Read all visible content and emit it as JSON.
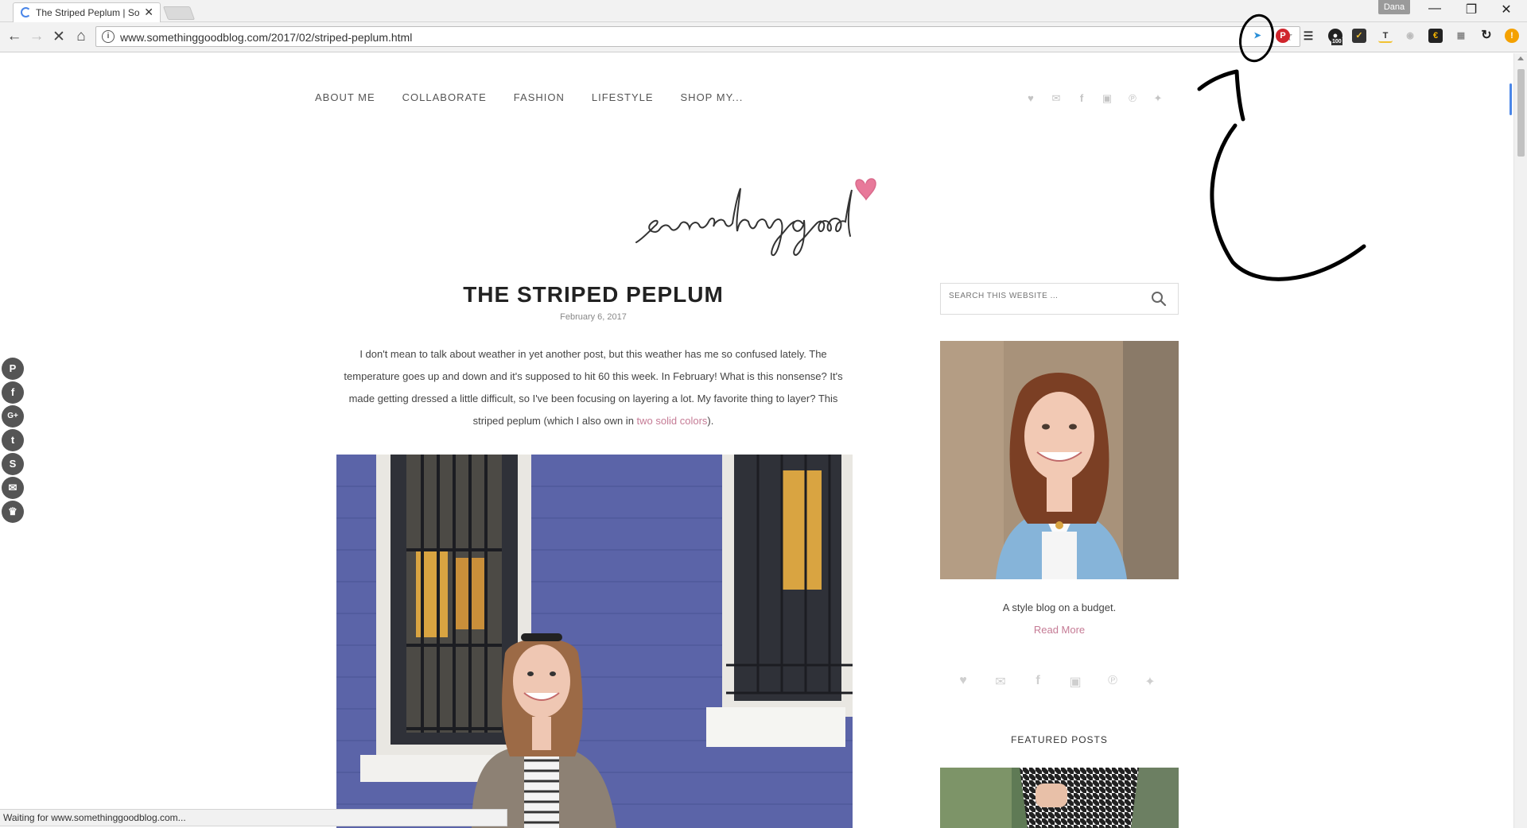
{
  "browser": {
    "tab_title": "The Striped Peplum | Sor",
    "tab_close": "✕",
    "profile_name": "Dana",
    "url": "www.somethinggoodblog.com/2017/02/striped-peplum.html",
    "status_text": "Waiting for www.somethinggoodblog.com...",
    "extension_badge": "100"
  },
  "nav": {
    "items": [
      "ABOUT ME",
      "COLLABORATE",
      "FASHION",
      "LIFESTYLE",
      "SHOP MY..."
    ]
  },
  "social_icons": [
    "heart-icon",
    "mail-icon",
    "facebook-icon",
    "instagram-icon",
    "pinterest-icon",
    "twitter-icon"
  ],
  "post": {
    "title": "THE STRIPED PEPLUM",
    "date": "February 6, 2017",
    "body_before_link": "I don't mean to talk about weather in yet another post, but this weather has me so confused lately. The temperature goes up and down and it's supposed to hit 60 this week. In February! What is this nonsense? It's made getting dressed a little difficult, so I've been focusing on layering a lot. My favorite thing to layer? This striped peplum (which I also own in ",
    "link_text": "two solid colors",
    "body_after_link": ")."
  },
  "sidebar": {
    "search_placeholder": "SEARCH THIS WEBSITE ...",
    "tagline": "A style blog on a budget.",
    "read_more": "Read More",
    "featured_heading": "FEATURED POSTS"
  },
  "share_buttons": [
    "P",
    "f",
    "G+",
    "t",
    "S",
    "✉",
    "♛"
  ],
  "colors": {
    "accent": "#c57b95",
    "wall": "#5b64a8",
    "share_button": "#555555"
  }
}
